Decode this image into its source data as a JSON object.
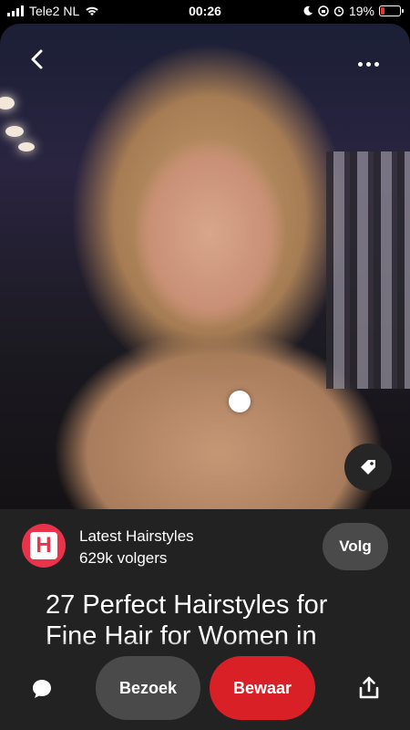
{
  "status_bar": {
    "carrier": "Tele2 NL",
    "time": "00:26",
    "battery_percent": "19%",
    "battery_level": 0.19,
    "battery_color": "#e33333"
  },
  "pin": {
    "image_alt": "",
    "icons": {
      "back": "chevron-left-icon",
      "more": "more-horizontal-icon",
      "tag": "tag-icon"
    }
  },
  "board": {
    "avatar_letter": "H",
    "avatar_color": "#e8334a",
    "name": "Latest Hairstyles",
    "followers": "629k volgers",
    "follow_label": "Volg"
  },
  "title": "27 Perfect Hairstyles for Fine Hair for Women in",
  "actions": {
    "visit_label": "Bezoek",
    "save_label": "Bewaar",
    "save_color": "#d92027",
    "icons": {
      "comment": "comment-icon",
      "share": "share-icon"
    }
  }
}
